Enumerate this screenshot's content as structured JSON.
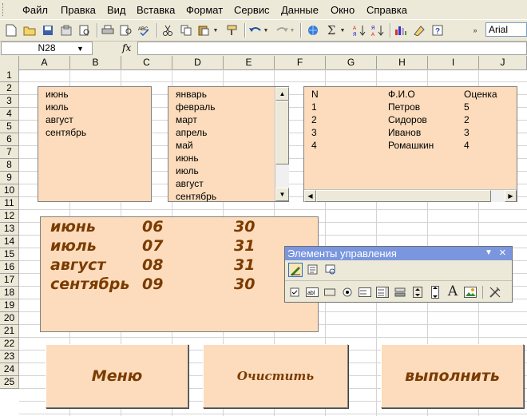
{
  "menu": [
    "Файл",
    "Правка",
    "Вид",
    "Вставка",
    "Формат",
    "Сервис",
    "Данные",
    "Окно",
    "Справка"
  ],
  "toolbar": {
    "font_name": "Arial",
    "icons": [
      "new-icon",
      "open-icon",
      "save-icon",
      "permission-icon",
      "print-icon",
      "print-preview-icon",
      "spelling-icon",
      "cut-icon",
      "copy-icon",
      "paste-icon",
      "format-painter-icon",
      "undo-icon",
      "redo-icon",
      "hyperlink-icon",
      "autosum-icon",
      "sort-asc-icon",
      "sort-desc-icon",
      "chart-wizard-icon",
      "drawing-icon",
      "help-icon"
    ]
  },
  "formula_bar": {
    "name_box": "N28",
    "fx": "fx",
    "value": ""
  },
  "columns": [
    "A",
    "B",
    "C",
    "D",
    "E",
    "F",
    "G",
    "H",
    "I",
    "J"
  ],
  "rows": [
    "1",
    "2",
    "3",
    "4",
    "5",
    "6",
    "7",
    "8",
    "9",
    "10",
    "11",
    "12",
    "13",
    "14",
    "15",
    "16",
    "17",
    "18",
    "19",
    "20",
    "21",
    "22",
    "23",
    "24",
    "25"
  ],
  "listbox1": {
    "items": [
      "июнь",
      "июль",
      "август",
      "сентябрь"
    ]
  },
  "listbox2": {
    "items": [
      "январь",
      "февраль",
      "март",
      "апрель",
      "май",
      "июнь",
      "июль",
      "август",
      "сентябрь"
    ]
  },
  "listbox3": {
    "headers": [
      "N",
      "Ф.И.О",
      "Оценка"
    ],
    "rows": [
      [
        "1",
        "Петров",
        "5"
      ],
      [
        "2",
        "Сидоров",
        "2"
      ],
      [
        "3",
        "Иванов",
        "3"
      ],
      [
        "4",
        "Ромашкин",
        "4"
      ]
    ]
  },
  "textbox": {
    "rows": [
      [
        "июнь",
        "06",
        "30"
      ],
      [
        "июль",
        "07",
        "31"
      ],
      [
        "август",
        "08",
        "31"
      ],
      [
        "сентябрь",
        "09",
        "30"
      ]
    ]
  },
  "buttons": {
    "menu": "Меню",
    "clear": "Очистить",
    "run": "выполнить"
  },
  "controls_toolbox": {
    "title": "Элементы управления",
    "close": "×",
    "collapse": "▼"
  }
}
